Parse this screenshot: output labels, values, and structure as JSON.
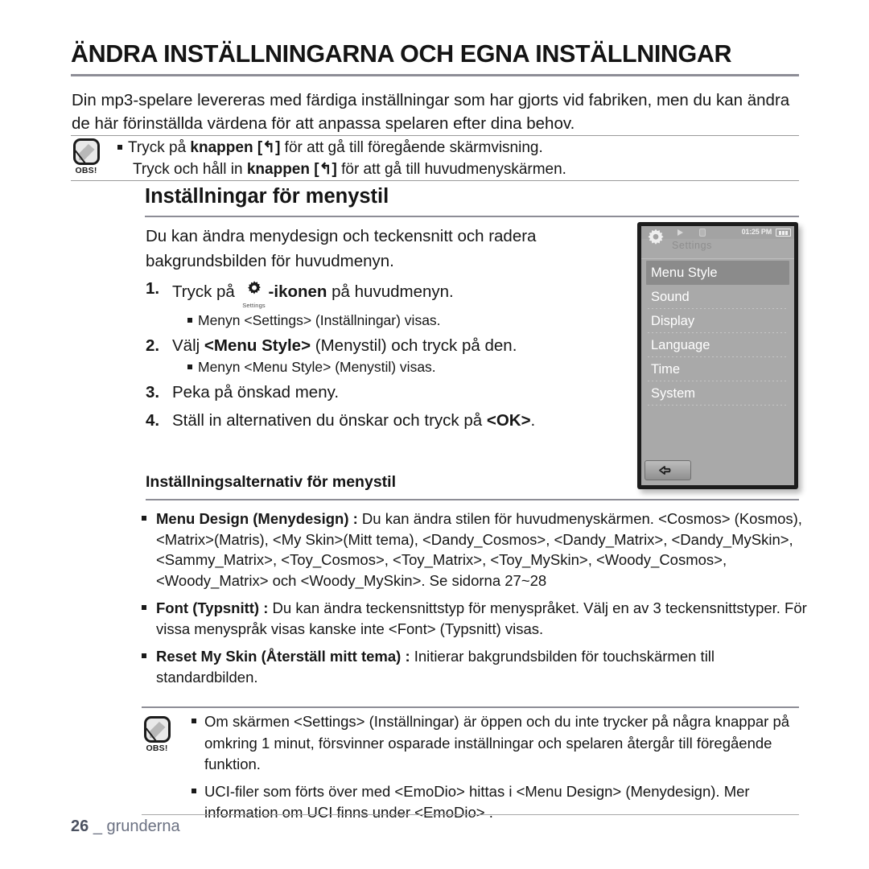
{
  "document": {
    "title": "ÄNDRA INSTÄLLNINGARNA OCH EGNA INSTÄLLNINGAR",
    "intro": "Din mp3-spelare levereras med färdiga inställningar som har gjorts vid fabriken, men du kan ändra de här förinställda värdena för att anpassa spelaren efter dina behov."
  },
  "note_top": {
    "icon_label": "OBS!",
    "line1_pre": "Tryck på ",
    "line1_bold": "knappen [",
    "line1_icon": "↰",
    "line1_bold_end": "]",
    "line1_post": " för att gå till föregående skärmvisning.",
    "line2_pre": "Tryck och håll in ",
    "line2_bold": "knappen [",
    "line2_icon": "↰",
    "line2_bold_end": "]",
    "line2_post": " för att gå till huvudmenyskärmen."
  },
  "section": {
    "heading": "Inställningar för menystil",
    "paragraph": "Du kan ändra menydesign och teckensnitt och radera bakgrundsbilden för huvudmenyn."
  },
  "steps": [
    {
      "num": "1.",
      "pre": "Tryck på ",
      "icon_caption": "Settings",
      "bold": "-ikonen",
      "post": " på huvudmenyn.",
      "sub": "Menyn <Settings> (Inställningar) visas."
    },
    {
      "num": "2.",
      "pre": "Välj ",
      "bold": "<Menu Style>",
      "post": " (Menystil) och tryck på den.",
      "sub": "Menyn <Menu Style> (Menystil) visas."
    },
    {
      "num": "3.",
      "pre": "Peka på önskad meny.",
      "bold": "",
      "post": "",
      "sub": ""
    },
    {
      "num": "4.",
      "pre": "Ställ in alternativen du önskar och tryck på ",
      "bold": "<OK>",
      "post": ".",
      "sub": ""
    }
  ],
  "options": {
    "heading": "Inställningsalternativ för menystil",
    "items": [
      {
        "label": "Menu Design (Menydesign) :",
        "text": " Du kan ändra stilen för huvudmenyskärmen. <Cosmos> (Kosmos), <Matrix>(Matris), <My Skin>(Mitt tema), <Dandy_Cosmos>, <Dandy_Matrix>, <Dandy_MySkin>, <Sammy_Matrix>, <Toy_Cosmos>, <Toy_Matrix>, <Toy_MySkin>, <Woody_Cosmos>, <Woody_Matrix> och <Woody_MySkin>. Se sidorna 27~28"
      },
      {
        "label": "Font (Typsnitt) :",
        "text": " Du kan ändra teckensnittstyp för menyspråket. Välj en av 3 teckensnittstyper. För vissa menyspråk visas kanske inte <Font> (Typsnitt) visas."
      },
      {
        "label": "Reset My Skin (Återställ mitt tema) :",
        "text": " Initierar bakgrundsbilden för touchskärmen till standardbilden."
      }
    ]
  },
  "note_bottom": {
    "icon_label": "OBS!",
    "items": [
      "Om skärmen <Settings> (Inställningar) är öppen och du inte trycker på några knappar på omkring 1 minut, försvinner osparade inställningar och spelaren återgår till föregående funktion.",
      "UCI-filer som förts över med <EmoDio> hittas i <Menu Design> (Menydesign). Mer information om UCI finns under <EmoDio> ."
    ]
  },
  "footer": {
    "page": "26",
    "sep": "_",
    "label": "grunderna"
  },
  "device": {
    "statusbar": {
      "time": "01:25 PM",
      "play_icon": "play-icon",
      "lock_icon": "lock-icon",
      "battery_icon": "battery-icon"
    },
    "screen_title": "Settings",
    "menu_items": [
      {
        "label": "Menu Style",
        "selected": true
      },
      {
        "label": "Sound",
        "selected": false
      },
      {
        "label": "Display",
        "selected": false
      },
      {
        "label": "Language",
        "selected": false
      },
      {
        "label": "Time",
        "selected": false
      },
      {
        "label": "System",
        "selected": false
      }
    ],
    "back_button_icon": "back-arrow-icon",
    "colors": {
      "screen_bg": "#a9a9a9",
      "selected_row": "#8b8b8b",
      "text": "#ffffff",
      "frame": "#1c1c1c"
    }
  }
}
